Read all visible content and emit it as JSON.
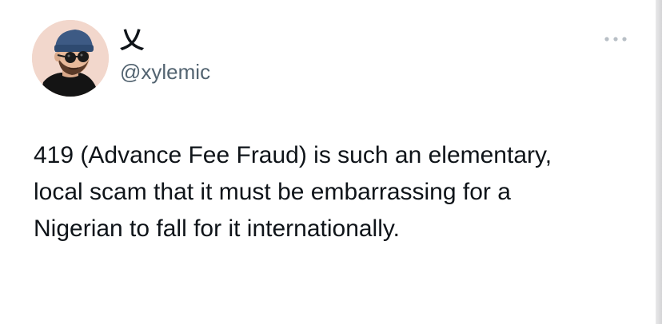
{
  "author": {
    "display_name": "乂",
    "handle": "@xylemic",
    "avatar_icon": "cartoon-man-beanie-sunglasses-avatar"
  },
  "actions": {
    "more_icon": "more-horizontal-icon"
  },
  "tweet": {
    "text": "419 (Advance Fee Fraud) is such an elementary, local scam that it must be embarrassing for a Nigerian to fall for it internationally."
  },
  "colors": {
    "text_primary": "#0f1419",
    "text_secondary": "#536471",
    "background": "#ffffff",
    "avatar_bg": "#f2d7cc"
  }
}
